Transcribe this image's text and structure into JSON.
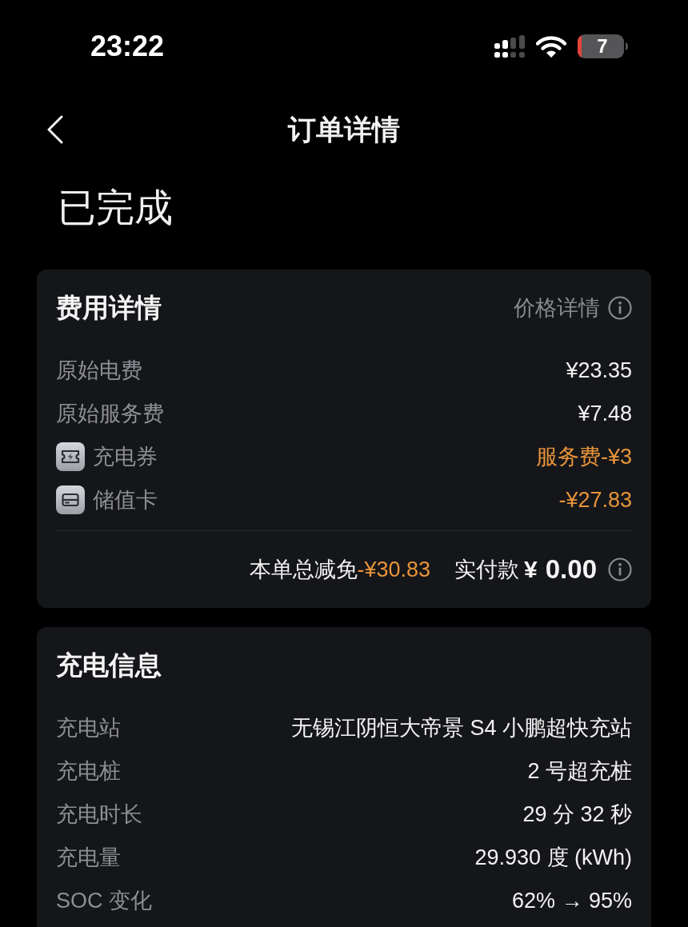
{
  "status_bar": {
    "time": "23:22",
    "battery": "7"
  },
  "nav": {
    "title": "订单详情"
  },
  "order_status": "已完成",
  "fee_details": {
    "title": "费用详情",
    "link": "价格详情",
    "rows": [
      {
        "kind": "fee",
        "label": "原始电费",
        "value": "¥23.35"
      },
      {
        "kind": "fee",
        "label": "原始服务费",
        "value": "¥7.48"
      },
      {
        "kind": "coupon",
        "label": "充电券",
        "value": "服务费-¥3"
      },
      {
        "kind": "stored_card",
        "label": "储值卡",
        "value": "-¥27.83"
      }
    ],
    "summary": {
      "discount_label": "本单总减免",
      "discount": "-¥30.83",
      "paid_label": "实付款",
      "currency": "¥",
      "paid": "0.00"
    }
  },
  "charging_info": {
    "title": "充电信息",
    "rows": [
      {
        "label": "充电站",
        "value": "无锡江阴恒大帝景 S4 小鹏超快充站"
      },
      {
        "label": "充电桩",
        "value": "2 号超充桩"
      },
      {
        "label": "充电时长",
        "value": "29 分 32 秒"
      },
      {
        "label": "充电量",
        "value": "29.930 度 (kWh)"
      },
      {
        "label": "SOC 变化",
        "value": "62% → 95%"
      }
    ]
  }
}
